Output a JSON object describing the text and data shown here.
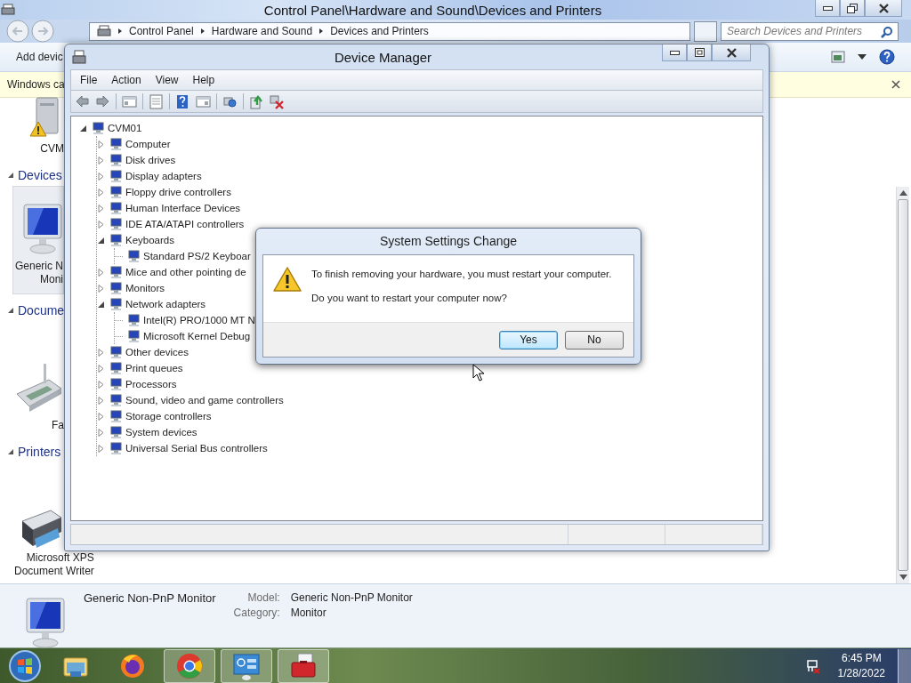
{
  "explorer": {
    "title": "Control Panel\\Hardware and Sound\\Devices and Printers",
    "breadcrumbs": [
      "Control Panel",
      "Hardware and Sound",
      "Devices and Printers"
    ],
    "search": {
      "placeholder": "Search Devices and Printers"
    },
    "command": "Add devic",
    "infobar": "Windows ca",
    "sections": [
      {
        "devices": [
          {
            "kind": "computer",
            "warning": true,
            "selected": false,
            "label": [
              "CVM"
            ]
          }
        ]
      },
      {
        "header": "Devices",
        "expanded": true,
        "devices": [
          {
            "kind": "monitor",
            "warning": false,
            "selected": true,
            "label": [
              "Generic N",
              "Moni"
            ]
          }
        ]
      },
      {
        "header": "Docume",
        "expanded": true,
        "devices": [
          {
            "kind": "fax",
            "warning": false,
            "selected": false,
            "label": [
              "Fa"
            ]
          }
        ]
      },
      {
        "header": "Printers",
        "expanded": true,
        "devices": [
          {
            "kind": "printer",
            "warning": false,
            "selected": false,
            "label": [
              "Microsoft XPS",
              "Document Writer"
            ]
          }
        ]
      }
    ],
    "details": {
      "name": "Generic Non-PnP Monitor",
      "fields": [
        {
          "label": "Model:",
          "value": "Generic Non-PnP Monitor"
        },
        {
          "label": "Category:",
          "value": "Monitor"
        }
      ]
    }
  },
  "device_manager": {
    "title": "Device Manager",
    "menu": [
      "File",
      "Action",
      "View",
      "Help"
    ],
    "tree": {
      "label": "CVM01",
      "expanded": true,
      "children": [
        {
          "label": "Computer",
          "expanded": false
        },
        {
          "label": "Disk drives",
          "expanded": false
        },
        {
          "label": "Display adapters",
          "expanded": false
        },
        {
          "label": "Floppy drive controllers",
          "expanded": false
        },
        {
          "label": "Human Interface Devices",
          "expanded": false
        },
        {
          "label": "IDE ATA/ATAPI controllers",
          "expanded": false
        },
        {
          "label": "Keyboards",
          "expanded": true,
          "children": [
            {
              "label": "Standard PS/2 Keyboar"
            }
          ]
        },
        {
          "label": "Mice and other pointing de",
          "expanded": false
        },
        {
          "label": "Monitors",
          "expanded": false
        },
        {
          "label": "Network adapters",
          "expanded": true,
          "children": [
            {
              "label": "Intel(R) PRO/1000 MT N"
            },
            {
              "label": "Microsoft Kernel Debug"
            }
          ]
        },
        {
          "label": "Other devices",
          "expanded": false
        },
        {
          "label": "Print queues",
          "expanded": false
        },
        {
          "label": "Processors",
          "expanded": false
        },
        {
          "label": "Sound, video and game controllers",
          "expanded": false
        },
        {
          "label": "Storage controllers",
          "expanded": false
        },
        {
          "label": "System devices",
          "expanded": false
        },
        {
          "label": "Universal Serial Bus controllers",
          "expanded": false
        }
      ]
    }
  },
  "dialog": {
    "title": "System Settings Change",
    "messages": [
      "To finish removing your hardware, you must restart your computer.",
      "Do you want to restart your computer now?"
    ],
    "buttons": [
      {
        "label": "Yes",
        "default": true
      },
      {
        "label": "No",
        "default": false
      }
    ]
  },
  "taskbar": {
    "apps": [
      {
        "kind": "explorer",
        "running": false
      },
      {
        "kind": "firefox",
        "running": false
      },
      {
        "kind": "chrome",
        "running": true
      },
      {
        "kind": "control-panel",
        "running": true
      },
      {
        "kind": "toolbox",
        "running": true
      }
    ],
    "clock": {
      "time": "6:45 PM",
      "date": "1/28/2022"
    }
  }
}
